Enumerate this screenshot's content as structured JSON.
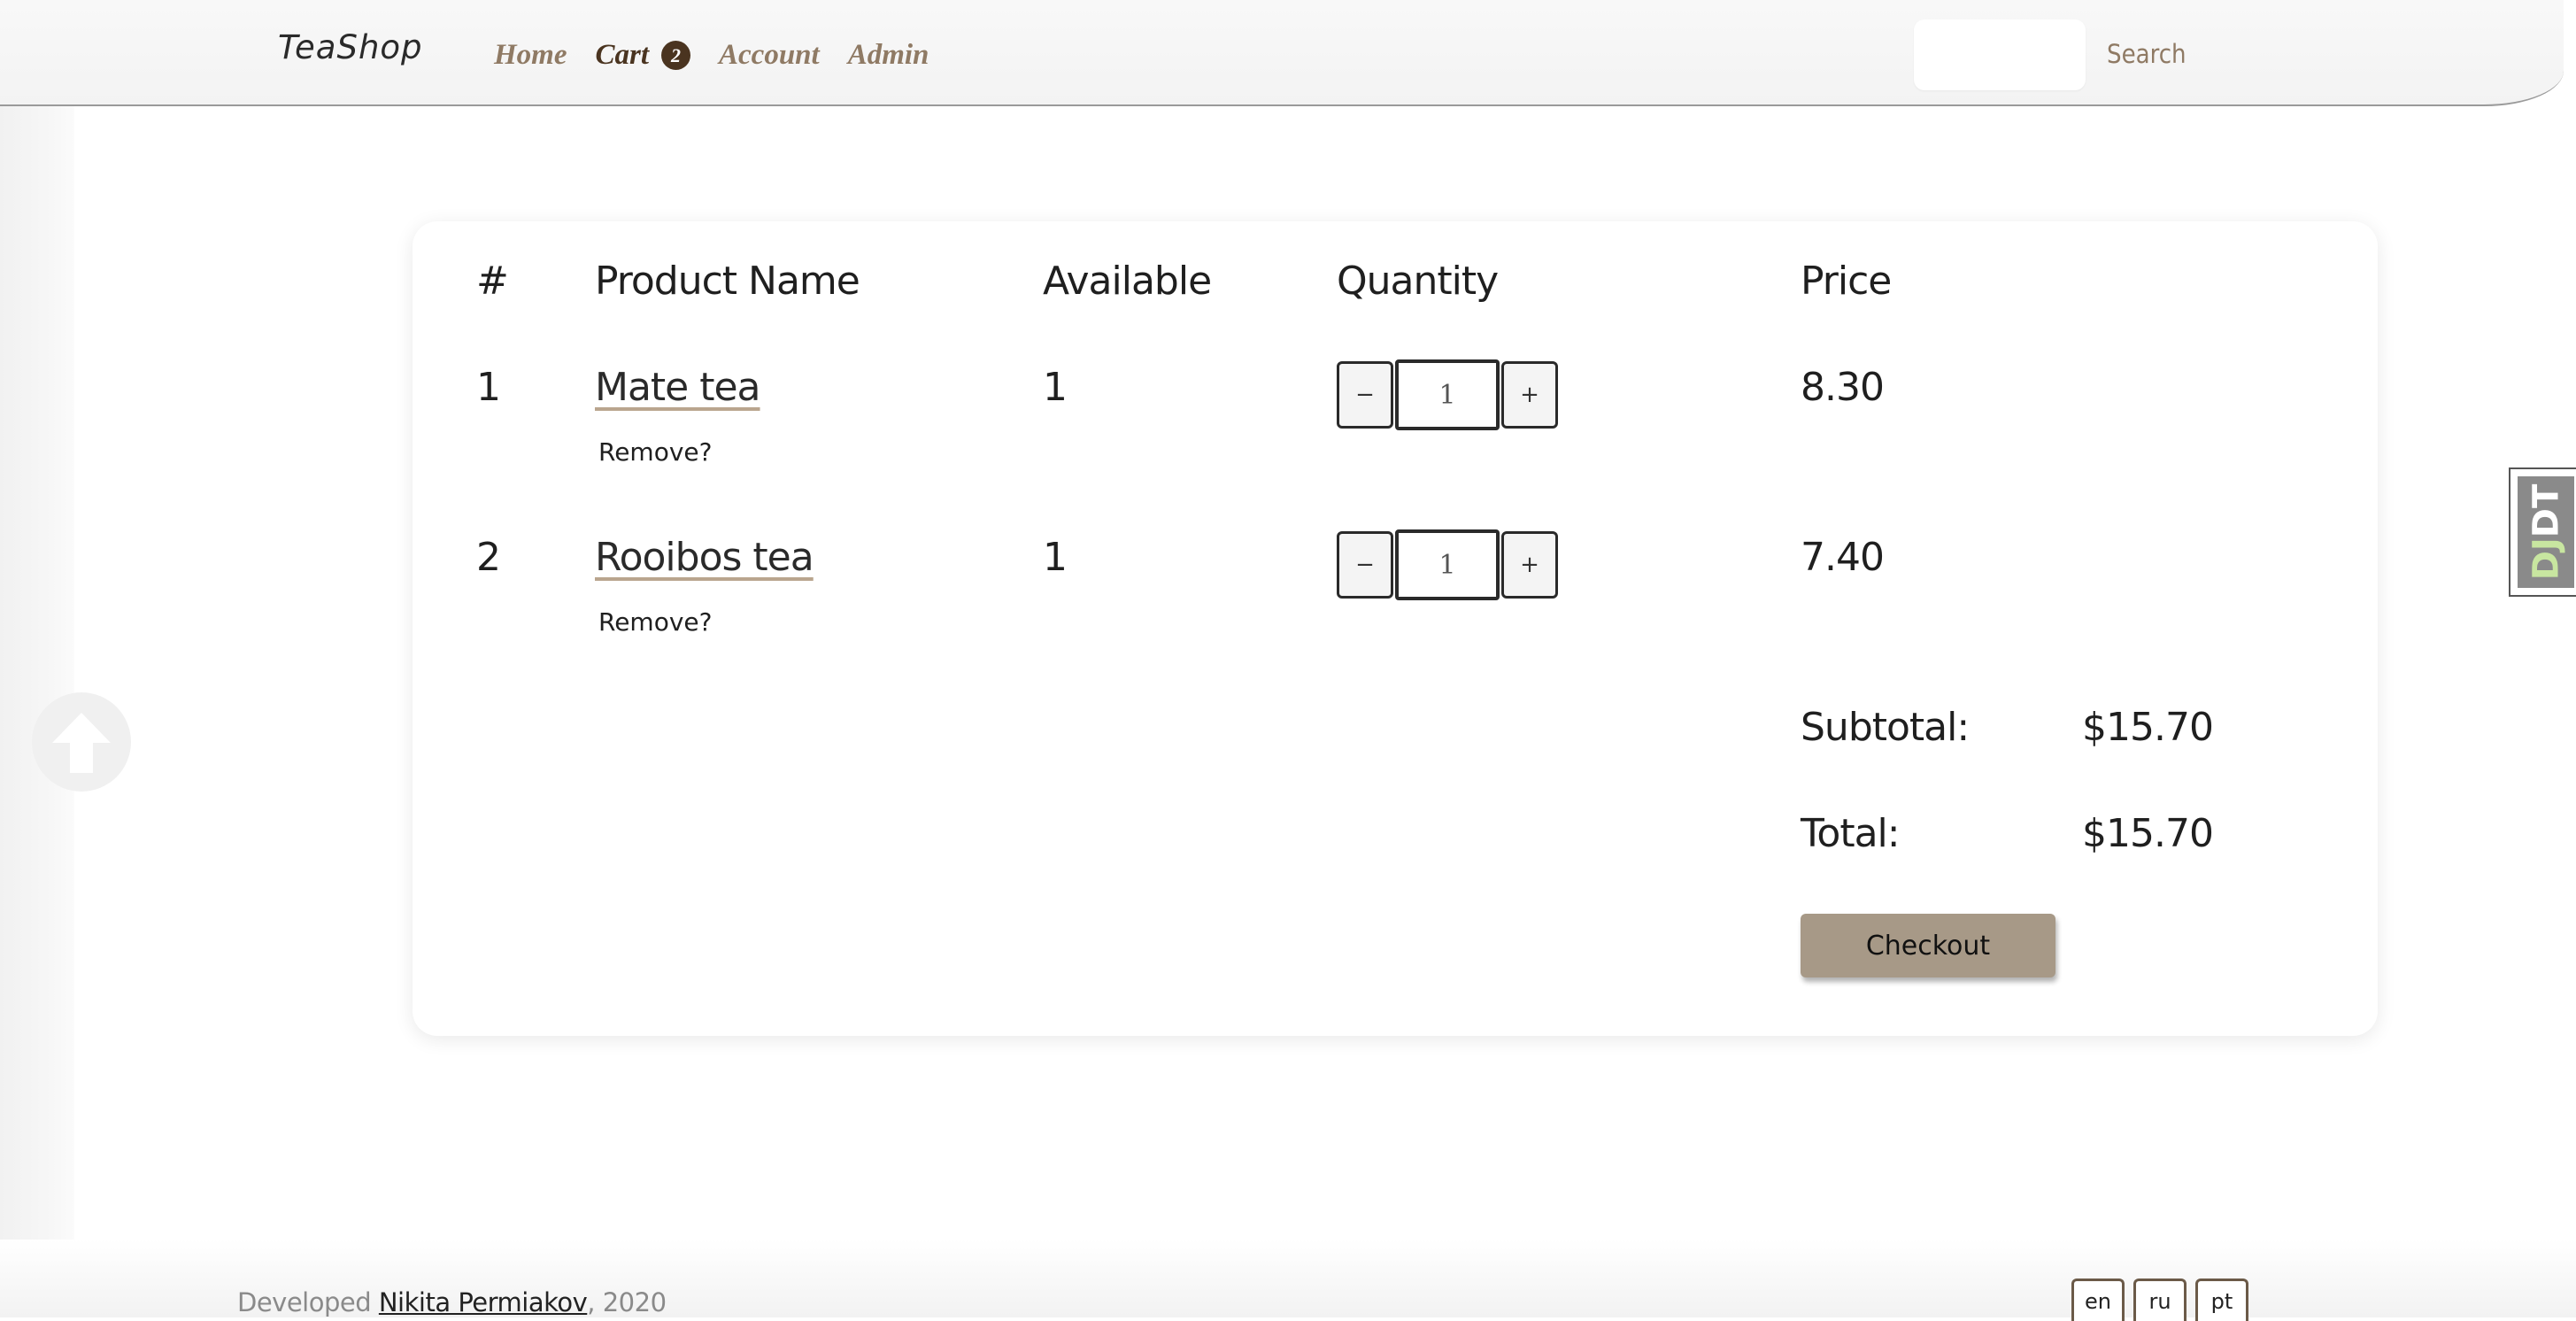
{
  "header": {
    "brand": "TeaShop",
    "nav": {
      "home": "Home",
      "cart": "Cart",
      "cart_count": "2",
      "account": "Account",
      "admin": "Admin"
    },
    "search_value": "",
    "search_button": "Search"
  },
  "cart": {
    "columns": {
      "index": "#",
      "product": "Product Name",
      "available": "Available",
      "quantity": "Quantity",
      "price": "Price"
    },
    "items": [
      {
        "index": "1",
        "name": "Mate tea",
        "remove": "Remove?",
        "available": "1",
        "quantity": "1",
        "price": "8.30",
        "minus": "−",
        "plus": "+"
      },
      {
        "index": "2",
        "name": "Rooibos tea",
        "remove": "Remove?",
        "available": "1",
        "quantity": "1",
        "price": "7.40",
        "minus": "−",
        "plus": "+"
      }
    ],
    "subtotal_label": "Subtotal:",
    "subtotal_value": "$15.70",
    "total_label": "Total:",
    "total_value": "$15.70",
    "checkout": "Checkout"
  },
  "debug_toolbar": {
    "label_dj": "DJ",
    "label_dt": "DT"
  },
  "footer": {
    "prefix": "Developed",
    "author": "Nikita Permiakov",
    "suffix": ", 2020",
    "languages": [
      "en",
      "ru",
      "pt"
    ]
  },
  "icons": {
    "scroll_top": "arrow-up-circle-icon"
  }
}
